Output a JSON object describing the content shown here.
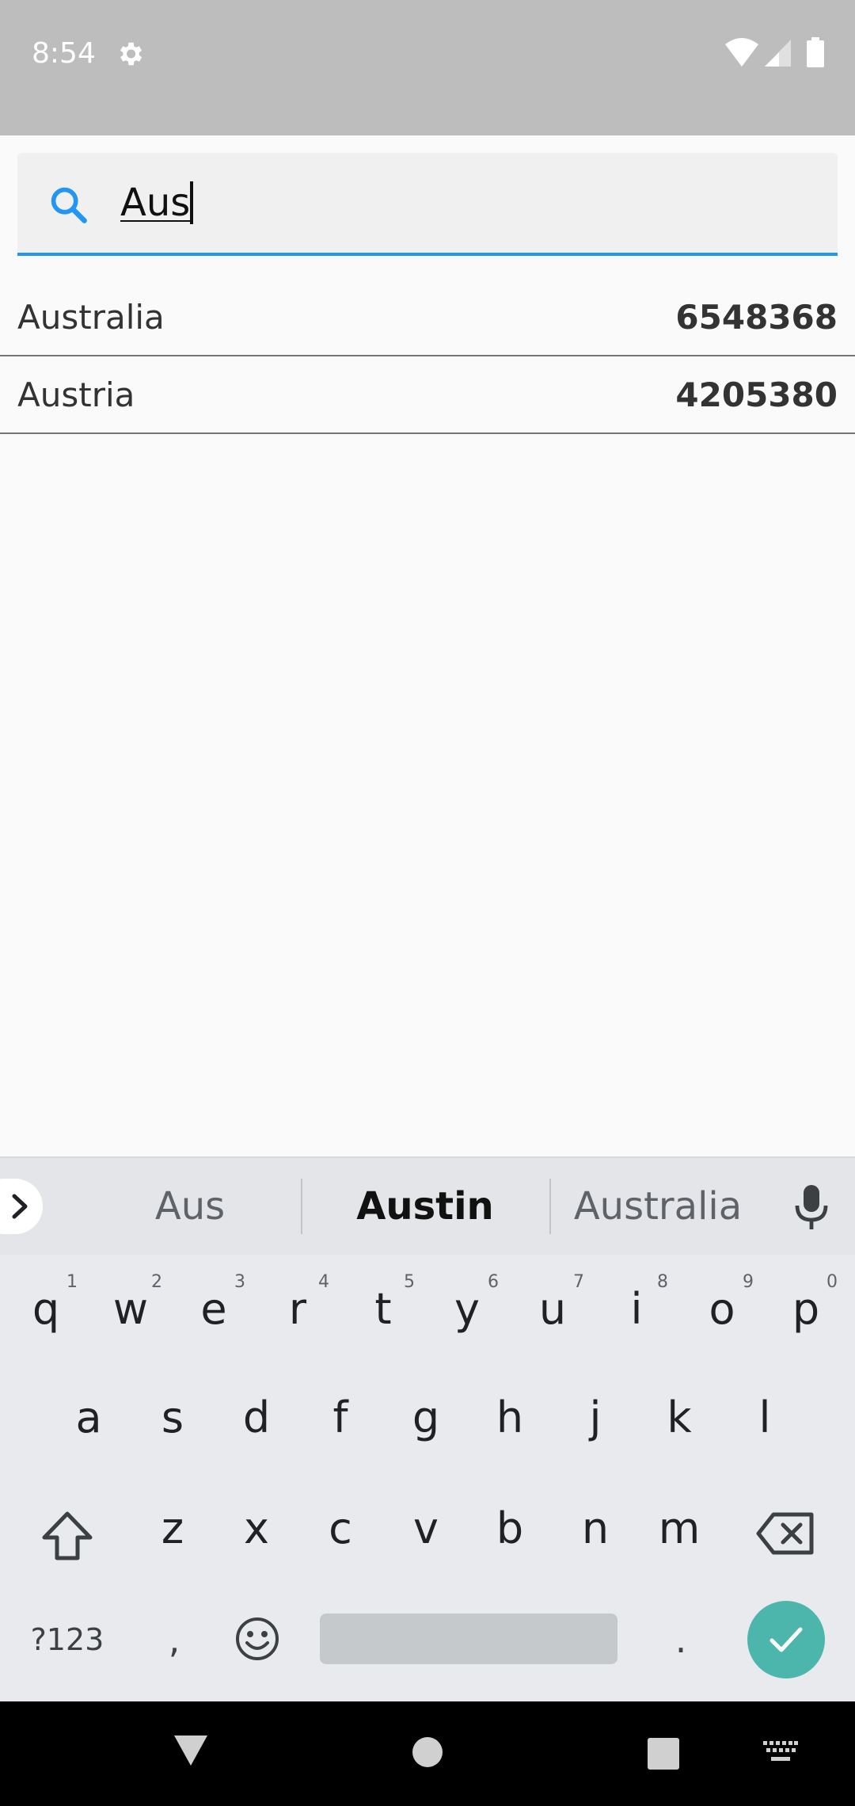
{
  "status_bar": {
    "time": "8:54",
    "icons": [
      "gear-icon",
      "wifi-icon",
      "cell-signal-icon",
      "battery-icon"
    ]
  },
  "search": {
    "value": "Aus",
    "accent_color": "#2196f3",
    "icon": "search-icon"
  },
  "results": [
    {
      "name": "Australia",
      "value": "6548368"
    },
    {
      "name": "Austria",
      "value": "4205380"
    }
  ],
  "keyboard": {
    "suggestions": [
      "Aus",
      "Austin",
      "Australia"
    ],
    "row1": [
      {
        "key": "q",
        "hint": "1"
      },
      {
        "key": "w",
        "hint": "2"
      },
      {
        "key": "e",
        "hint": "3"
      },
      {
        "key": "r",
        "hint": "4"
      },
      {
        "key": "t",
        "hint": "5"
      },
      {
        "key": "y",
        "hint": "6"
      },
      {
        "key": "u",
        "hint": "7"
      },
      {
        "key": "i",
        "hint": "8"
      },
      {
        "key": "o",
        "hint": "9"
      },
      {
        "key": "p",
        "hint": "0"
      }
    ],
    "row2": [
      "a",
      "s",
      "d",
      "f",
      "g",
      "h",
      "j",
      "k",
      "l"
    ],
    "row3": [
      "z",
      "x",
      "c",
      "v",
      "b",
      "n",
      "m"
    ],
    "symbols_label": "?123",
    "comma": ",",
    "period": ".",
    "enter_color": "#4db6ac"
  }
}
